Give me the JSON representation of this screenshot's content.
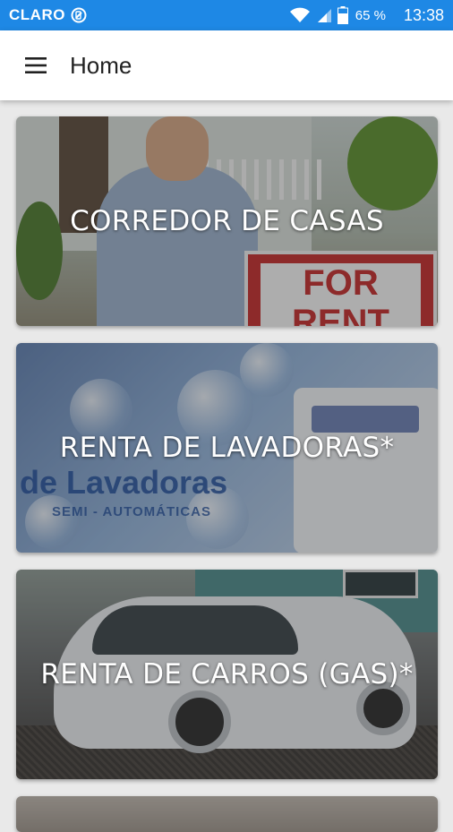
{
  "status_bar": {
    "carrier": "CLARO",
    "battery_percent": "65 %",
    "time": "13:38",
    "icons": [
      "no-sim-circle-icon",
      "wifi-icon",
      "signal-icon",
      "battery-icon"
    ]
  },
  "app_bar": {
    "title": "Home",
    "menu_icon": "hamburger-menu-icon"
  },
  "cards": [
    {
      "label": "CORREDOR DE CASAS"
    },
    {
      "label": "RENTA DE LAVADORAS*",
      "image_text": "de Lavadoras",
      "image_subtext": "SEMI - AUTOMÁTICAS"
    },
    {
      "label": "RENTA DE CARROS (GAS)*"
    },
    {
      "label": ""
    }
  ],
  "sign_text": "FOR RENT",
  "colors": {
    "status_bar": "#1e88e5",
    "app_bar": "#ffffff",
    "background": "#e9e9e9",
    "card_label": "#ffffff"
  }
}
